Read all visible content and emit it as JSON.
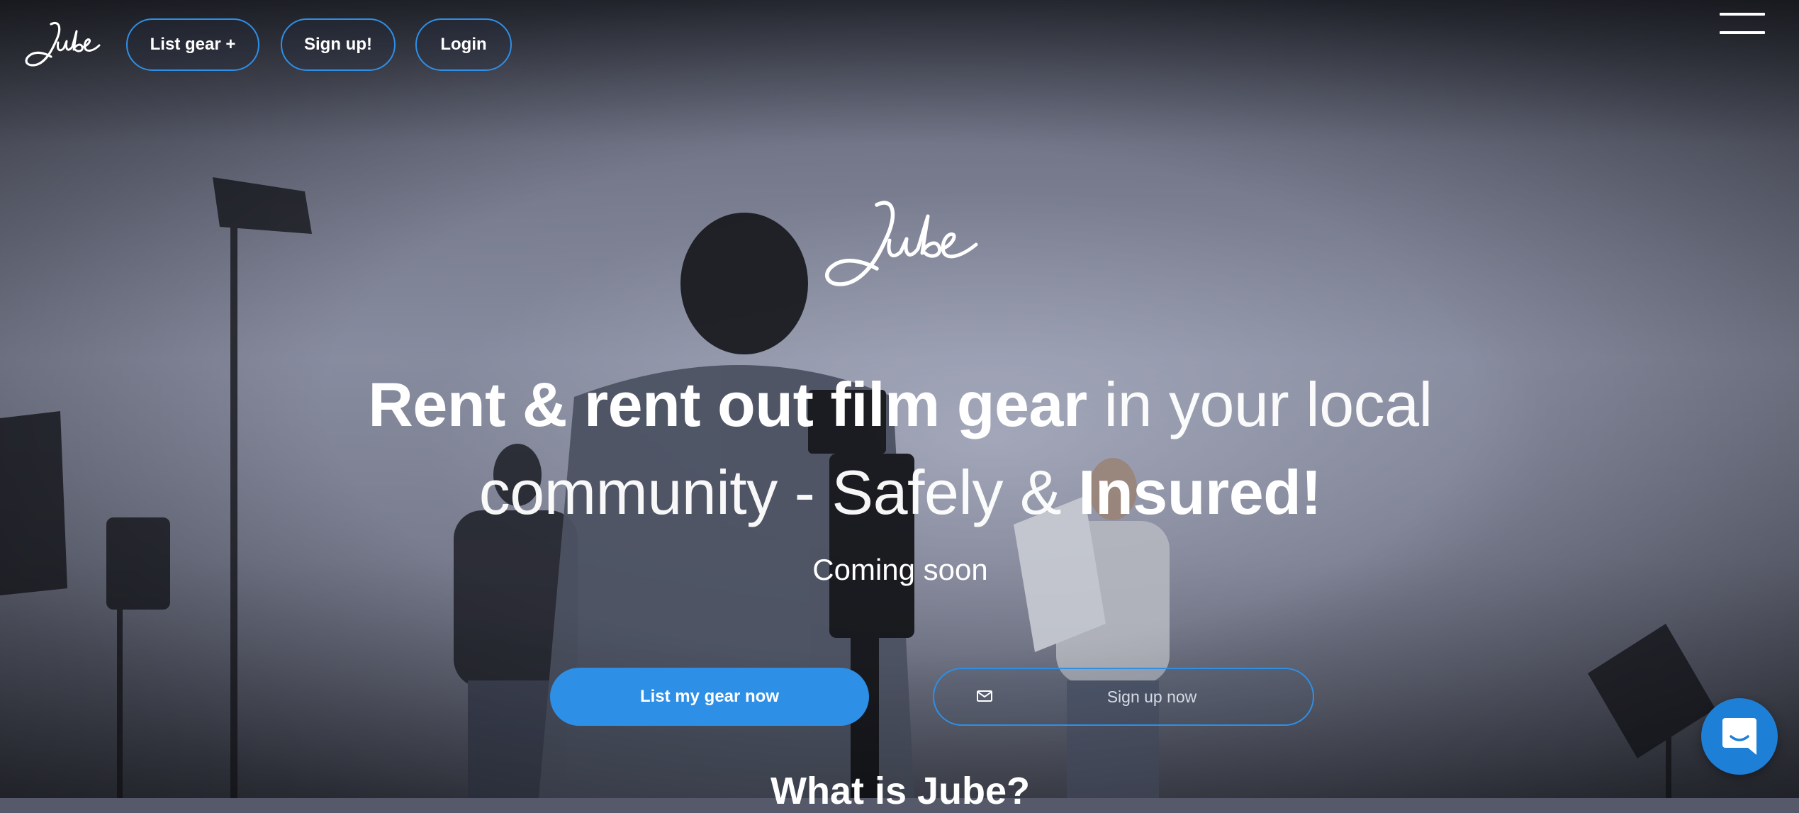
{
  "brand": {
    "logo_text": "Jube"
  },
  "nav": {
    "list_gear": "List gear +",
    "sign_up": "Sign up!",
    "login": "Login"
  },
  "hero": {
    "headline_part1": "Rent & rent out film gear",
    "headline_part2": " in your local community - Safely & ",
    "headline_part3": "Insured!",
    "coming_soon": "Coming soon",
    "cta_primary": "List my gear now",
    "cta_secondary_placeholder": "Sign up now",
    "section_title": "What is Jube?"
  },
  "icons": {
    "menu": "hamburger-icon",
    "mail": "envelope-icon",
    "chat": "chat-bubble-icon"
  },
  "colors": {
    "accent": "#2e8fe6",
    "text": "#ffffff"
  }
}
